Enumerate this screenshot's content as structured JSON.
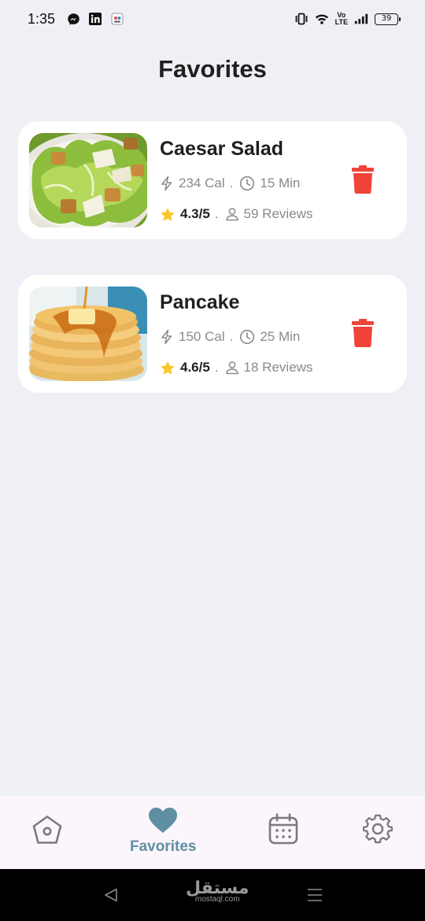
{
  "status_bar": {
    "time": "1:35",
    "battery": "39",
    "network_label_top": "Vo",
    "network_label_bottom": "LTE",
    "notification_icons": [
      "messenger-icon",
      "linkedin-icon",
      "app-notification-icon"
    ],
    "system_icons": [
      "vibrate-icon",
      "wifi-icon",
      "signal-icon",
      "battery-icon"
    ]
  },
  "page": {
    "title": "Favorites"
  },
  "favorites": [
    {
      "title": "Caesar Salad",
      "calories": "234 Cal",
      "separator": ".",
      "time": "15 Min",
      "rating": "4.3/5",
      "rating_separator": ".",
      "reviews": "59 Reviews",
      "image": "caesar-salad-photo"
    },
    {
      "title": "Pancake",
      "calories": "150 Cal",
      "separator": ".",
      "time": "25 Min",
      "rating": "4.6/5",
      "rating_separator": ".",
      "reviews": "18 Reviews",
      "image": "pancake-photo"
    }
  ],
  "bottom_nav": {
    "items": [
      {
        "name": "home",
        "icon": "home-icon"
      },
      {
        "name": "favorites",
        "icon": "heart-icon",
        "label": "Favorites",
        "active": true
      },
      {
        "name": "calendar",
        "icon": "calendar-icon"
      },
      {
        "name": "settings",
        "icon": "gear-icon"
      }
    ]
  },
  "system_nav": {
    "watermark_main": "مستقل",
    "watermark_sub": "mostaql.com"
  },
  "colors": {
    "background": "#eff0f5",
    "accent": "#5f8fa3",
    "delete": "#f0433a",
    "star": "#fbc72c",
    "nav_background": "#fbf5fc"
  }
}
